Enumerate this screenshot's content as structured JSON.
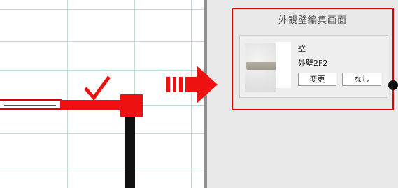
{
  "panel": {
    "title": "外観壁編集画面",
    "category": "壁",
    "material_name": "外壁2F2",
    "change_button": "変更",
    "none_button": "なし"
  },
  "colors": {
    "highlight_red": "#e20000",
    "wall_selected": "#ee1111",
    "grid_line": "#b9dcd6"
  },
  "icons": [
    "checkmark-icon",
    "right-arrow-icon",
    "indicator-dot-icon"
  ]
}
